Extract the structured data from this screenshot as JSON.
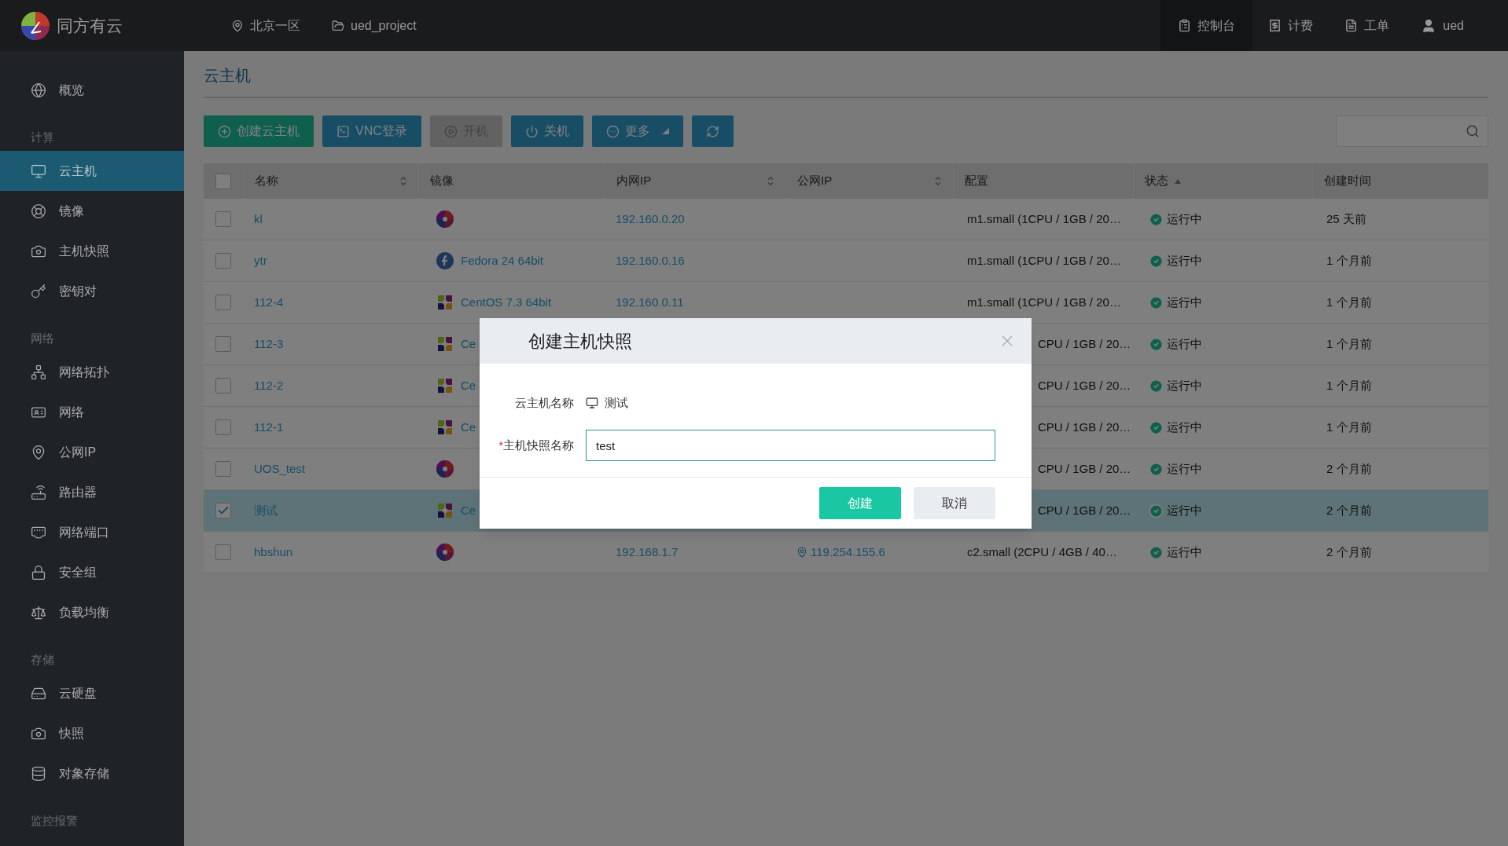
{
  "topbar": {
    "logo": "同方有云",
    "region": "北京一区",
    "project": "ued_project",
    "nav": [
      {
        "label": "控制台",
        "selected": true
      },
      {
        "label": "计费",
        "selected": false
      },
      {
        "label": "工单",
        "selected": false
      }
    ],
    "user": "ued"
  },
  "sidebar": {
    "sections": [
      {
        "items": [
          {
            "label": "概览",
            "selected": false
          }
        ]
      },
      {
        "heading": "计算",
        "items": [
          {
            "label": "云主机",
            "selected": true
          },
          {
            "label": "镜像",
            "selected": false
          },
          {
            "label": "主机快照",
            "selected": false
          },
          {
            "label": "密钥对",
            "selected": false
          }
        ]
      },
      {
        "heading": "网络",
        "items": [
          {
            "label": "网络拓扑",
            "selected": false
          },
          {
            "label": "网络",
            "selected": false
          },
          {
            "label": "公网IP",
            "selected": false
          },
          {
            "label": "路由器",
            "selected": false
          },
          {
            "label": "网络端口",
            "selected": false
          },
          {
            "label": "安全组",
            "selected": false
          },
          {
            "label": "负载均衡",
            "selected": false
          }
        ]
      },
      {
        "heading": "存储",
        "items": [
          {
            "label": "云硬盘",
            "selected": false
          },
          {
            "label": "快照",
            "selected": false
          },
          {
            "label": "对象存储",
            "selected": false
          }
        ]
      },
      {
        "heading": "监控报警"
      }
    ]
  },
  "page": {
    "title": "云主机"
  },
  "toolbar": [
    {
      "kind": "primary",
      "label": "创建云主机",
      "disabled": false
    },
    {
      "kind": "normal",
      "label": "VNC登录",
      "disabled": false
    },
    {
      "kind": "normal",
      "label": "开机",
      "disabled": true
    },
    {
      "kind": "normal",
      "label": "关机",
      "disabled": false
    },
    {
      "kind": "menu",
      "label": "更多",
      "disabled": false
    },
    {
      "kind": "normal",
      "disabled": false
    }
  ],
  "table": {
    "columns": [
      {
        "label": "名称",
        "kind": "sortable"
      },
      {
        "label": "镜像",
        "kind": "plain"
      },
      {
        "label": "内网IP",
        "kind": "sortable"
      },
      {
        "label": "公网IP",
        "kind": "sortable"
      },
      {
        "label": "配置",
        "kind": "plain"
      },
      {
        "label": "状态",
        "kind": "sorted"
      },
      {
        "label": "创建时间",
        "kind": "plain"
      }
    ],
    "all_checked": false,
    "rows": [
      {
        "name": "kl",
        "image": {
          "kind": "generic"
        },
        "inner_ip": "192.160.0.20",
        "config": "m1.small (1CPU / 1GB / 20…",
        "covered": false,
        "status": "运行中",
        "created": "25 天前",
        "checked": false,
        "selected": false
      },
      {
        "name": "ytr",
        "image": {
          "kind": "fedora",
          "label": "Fedora 24 64bit"
        },
        "inner_ip": "192.160.0.16",
        "config": "m1.small (1CPU / 1GB / 20…",
        "covered": false,
        "status": "运行中",
        "created": "1 个月前",
        "checked": false,
        "selected": false
      },
      {
        "name": "112-4",
        "image": {
          "kind": "centos",
          "label": "CentOS 7.3 64bit"
        },
        "inner_ip": "192.160.0.11",
        "config": "m1.small (1CPU / 1GB / 20…",
        "covered": false,
        "status": "运行中",
        "created": "1 个月前",
        "checked": false,
        "selected": false
      },
      {
        "name": "112-3",
        "image": {
          "kind": "centos",
          "label": "Ce"
        },
        "config": "CPU / 1GB / 20…",
        "covered": true,
        "status": "运行中",
        "created": "1 个月前",
        "checked": false,
        "selected": false
      },
      {
        "name": "112-2",
        "image": {
          "kind": "centos",
          "label": "Ce"
        },
        "config": "CPU / 1GB / 20…",
        "covered": true,
        "status": "运行中",
        "created": "1 个月前",
        "checked": false,
        "selected": false
      },
      {
        "name": "112-1",
        "image": {
          "kind": "centos",
          "label": "Ce"
        },
        "config": "CPU / 1GB / 20…",
        "covered": true,
        "status": "运行中",
        "created": "1 个月前",
        "checked": false,
        "selected": false
      },
      {
        "name": "UOS_test",
        "image": {
          "kind": "generic"
        },
        "config": "CPU / 1GB / 20…",
        "covered": true,
        "status": "运行中",
        "created": "2 个月前",
        "checked": false,
        "selected": false
      },
      {
        "name": "测试",
        "image": {
          "kind": "centos",
          "label": "Ce"
        },
        "config": "CPU / 1GB / 20…",
        "covered": true,
        "status": "运行中",
        "created": "2 个月前",
        "checked": true,
        "selected": true
      },
      {
        "name": "hbshun",
        "image": {
          "kind": "generic"
        },
        "inner_ip": "192.168.1.7",
        "public_ip": "119.254.155.6",
        "config": "c2.small (2CPU / 4GB / 40…",
        "covered": false,
        "status": "运行中",
        "created": "2 个月前",
        "checked": false,
        "selected": false
      }
    ]
  },
  "dialog": {
    "title": "创建主机快照",
    "fields": [
      {
        "kind": "static",
        "label": "云主机名称",
        "value": "测试"
      },
      {
        "kind": "input",
        "marker": "*",
        "label": "主机快照名称",
        "value": "test"
      }
    ],
    "buttons": [
      {
        "kind": "primary",
        "label": "创建"
      },
      {
        "kind": "secondary",
        "label": "取消"
      }
    ]
  }
}
